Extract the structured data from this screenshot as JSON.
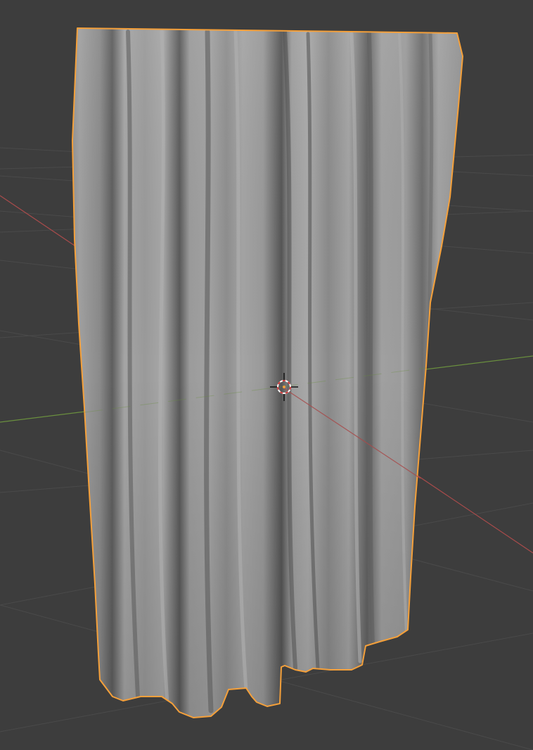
{
  "viewport": {
    "background_color": "#3d3d3d",
    "grid_line_color": "#4a4a4a",
    "x_axis_color": "#a84b4b",
    "y_axis_color": "#6a8f3e"
  },
  "object": {
    "type": "cloth-curtain-mesh",
    "selected": true,
    "outline_color": "#f5a03a",
    "base_color": "#8f8f8f"
  },
  "cursor": {
    "icon": "3d-cursor-icon",
    "ring_color_a": "#ffffff",
    "ring_color_b": "#d23b3b"
  }
}
